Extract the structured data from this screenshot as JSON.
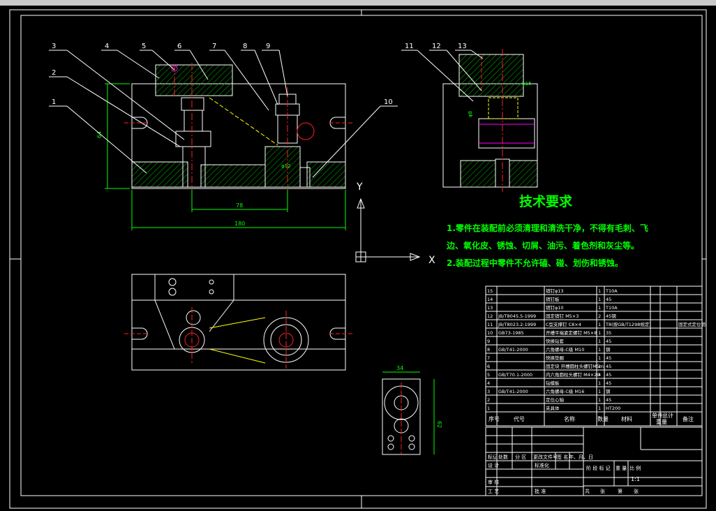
{
  "titlebar": {
    "present": true
  },
  "drawing": {
    "colors": {
      "background": "#000000",
      "outline": "#ffffff",
      "hatch": "#00a000",
      "centerline": "#ff2020",
      "dimension": "#00ff00",
      "leader": "#ffffff",
      "yellow": "#ffff00",
      "magenta": "#ff00ff",
      "cyan": "#00ffff",
      "tech_text": "#00ff00"
    },
    "part_numbers": [
      "1",
      "2",
      "3",
      "4",
      "5",
      "6",
      "7",
      "8",
      "9",
      "10",
      "11",
      "12",
      "13"
    ],
    "dimensions": {
      "front_height": "64",
      "front_span_78": "78",
      "front_width": "180",
      "bore_dia": "φ12",
      "side_dia": "φ15",
      "side_h": "φ8",
      "small_width": "34",
      "small_height": "62"
    },
    "ucs": {
      "y_label": "Y",
      "x_label": "X"
    },
    "tech_requirements": {
      "title": "技术要求",
      "lines": [
        "1.零件在装配前必须清理和清洗干净，不得有毛刺、飞",
        "边、氧化皮、锈蚀、切屑、油污、着色剂和灰尘等。",
        "2.装配过程中零件不允许磕、碰、划伤和锈蚀。"
      ]
    },
    "bom": {
      "rows": [
        {
          "no": "15",
          "code": "",
          "name": "销钉φ13",
          "qty": "1",
          "material": "T10A",
          "mass": "",
          "remark": ""
        },
        {
          "no": "14",
          "code": "",
          "name": "销钉板",
          "qty": "1",
          "material": "45",
          "mass": "",
          "remark": ""
        },
        {
          "no": "13",
          "code": "",
          "name": "销钉φ10",
          "qty": "1",
          "material": "T10A",
          "mass": "",
          "remark": ""
        },
        {
          "no": "12",
          "code": "JB/T8045.5-1999",
          "name": "固定销钉 M5×3",
          "qty": "2",
          "material": "45钢",
          "mass": "",
          "remark": ""
        },
        {
          "no": "11",
          "code": "JB/T8023.2-1999",
          "name": "C型支撑钉 C8×4",
          "qty": "1",
          "material": "T8(按GB/T1298规定)",
          "mass": "",
          "remark": "固定式定位销"
        },
        {
          "no": "10",
          "code": "GB73-1985",
          "name": "开槽平端紧定螺钉 M5×8",
          "qty": "1",
          "material": "35",
          "mass": "",
          "remark": ""
        },
        {
          "no": "9",
          "code": "",
          "name": "快换钻套",
          "qty": "1",
          "material": "45",
          "mass": "",
          "remark": ""
        },
        {
          "no": "8",
          "code": "GB/T41-2000",
          "name": "六角螺母-C级 M10",
          "qty": "1",
          "material": "钢",
          "mass": "",
          "remark": ""
        },
        {
          "no": "7",
          "code": "",
          "name": "快换垫圈",
          "qty": "1",
          "material": "45",
          "mass": "",
          "remark": ""
        },
        {
          "no": "6",
          "code": "",
          "name": "固定块 开槽圆柱头螺钉M5m",
          "qty": "1",
          "material": "45",
          "mass": "",
          "remark": ""
        },
        {
          "no": "5",
          "code": "GB/T70.1-2000",
          "name": "内六角圆柱头螺钉 M4×20",
          "qty": "4",
          "material": "45",
          "mass": "",
          "remark": ""
        },
        {
          "no": "4",
          "code": "",
          "name": "钻模板",
          "qty": "1",
          "material": "45",
          "mass": "",
          "remark": ""
        },
        {
          "no": "3",
          "code": "GB/T41-2000",
          "name": "六角螺母-C级 M16",
          "qty": "1",
          "material": "钢",
          "mass": "",
          "remark": ""
        },
        {
          "no": "2",
          "code": "",
          "name": "定位心轴",
          "qty": "1",
          "material": "45",
          "mass": "",
          "remark": ""
        },
        {
          "no": "1",
          "code": "",
          "name": "夹具体",
          "qty": "1",
          "material": "HT200",
          "mass": "",
          "remark": ""
        }
      ],
      "header": {
        "no": "序号",
        "code": "代号",
        "name": "名称",
        "qty": "数量",
        "material": "材料",
        "single": "单件",
        "total": "总计",
        "mass": "重量",
        "remark": "备注"
      }
    },
    "title_block": {
      "r1": [
        "标记",
        "处数",
        "分 区",
        "更改文件号",
        "签 名",
        "年、月、日"
      ],
      "design": "设 计",
      "std": "标准化",
      "stage": [
        "阶 段 标 记",
        "重 量",
        "比 例"
      ],
      "scale": "1:1",
      "check": "审 核",
      "process": "工 艺",
      "approve": "批 准",
      "sheet": [
        "共",
        "张",
        "第",
        "张"
      ]
    }
  }
}
